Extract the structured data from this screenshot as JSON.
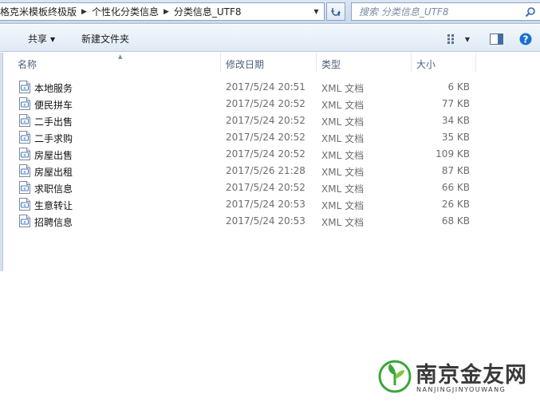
{
  "address_bar": {
    "crumbs": [
      "格克米模板终极版",
      "个性化分类信息",
      "分类信息_UTF8"
    ]
  },
  "search": {
    "placeholder": "搜索 分类信息_UTF8"
  },
  "toolbar": {
    "share_label": "共享",
    "new_folder_label": "新建文件夹"
  },
  "columns": {
    "name": "名称",
    "date": "修改日期",
    "type": "类型",
    "size": "大小"
  },
  "files": [
    {
      "name": "本地服务",
      "date": "2017/5/24 20:51",
      "type": "XML 文档",
      "size": "6 KB"
    },
    {
      "name": "便民拼车",
      "date": "2017/5/24 20:52",
      "type": "XML 文档",
      "size": "77 KB"
    },
    {
      "name": "二手出售",
      "date": "2017/5/24 20:52",
      "type": "XML 文档",
      "size": "34 KB"
    },
    {
      "name": "二手求购",
      "date": "2017/5/24 20:52",
      "type": "XML 文档",
      "size": "35 KB"
    },
    {
      "name": "房屋出售",
      "date": "2017/5/24 20:52",
      "type": "XML 文档",
      "size": "109 KB"
    },
    {
      "name": "房屋出租",
      "date": "2017/5/26 21:28",
      "type": "XML 文档",
      "size": "87 KB"
    },
    {
      "name": "求职信息",
      "date": "2017/5/24 20:52",
      "type": "XML 文档",
      "size": "66 KB"
    },
    {
      "name": "生意转让",
      "date": "2017/5/24 20:53",
      "type": "XML 文档",
      "size": "26 KB"
    },
    {
      "name": "招聘信息",
      "date": "2017/5/24 20:53",
      "type": "XML 文档",
      "size": "68 KB"
    }
  ],
  "watermark": {
    "title": "南京金友网",
    "subtitle": "NANJINGJINYOUWANG"
  },
  "colors": {
    "accent": "#1a6fd0",
    "header_text": "#4c607a",
    "meta_text": "#6d6d6d",
    "watermark_green": "#3aa63a"
  }
}
